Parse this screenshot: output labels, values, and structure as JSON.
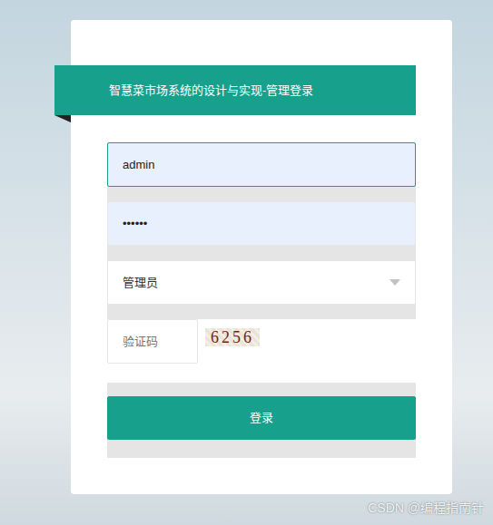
{
  "title": "智慧菜市场系统的设计与实现-管理登录",
  "username": {
    "value": "admin",
    "focused": true
  },
  "password": {
    "value": "••••••"
  },
  "role": {
    "value": "管理员"
  },
  "captcha": {
    "placeholder": "验证码",
    "code": "6256"
  },
  "submit": "登录",
  "watermark": "CSDN @编程指南针"
}
